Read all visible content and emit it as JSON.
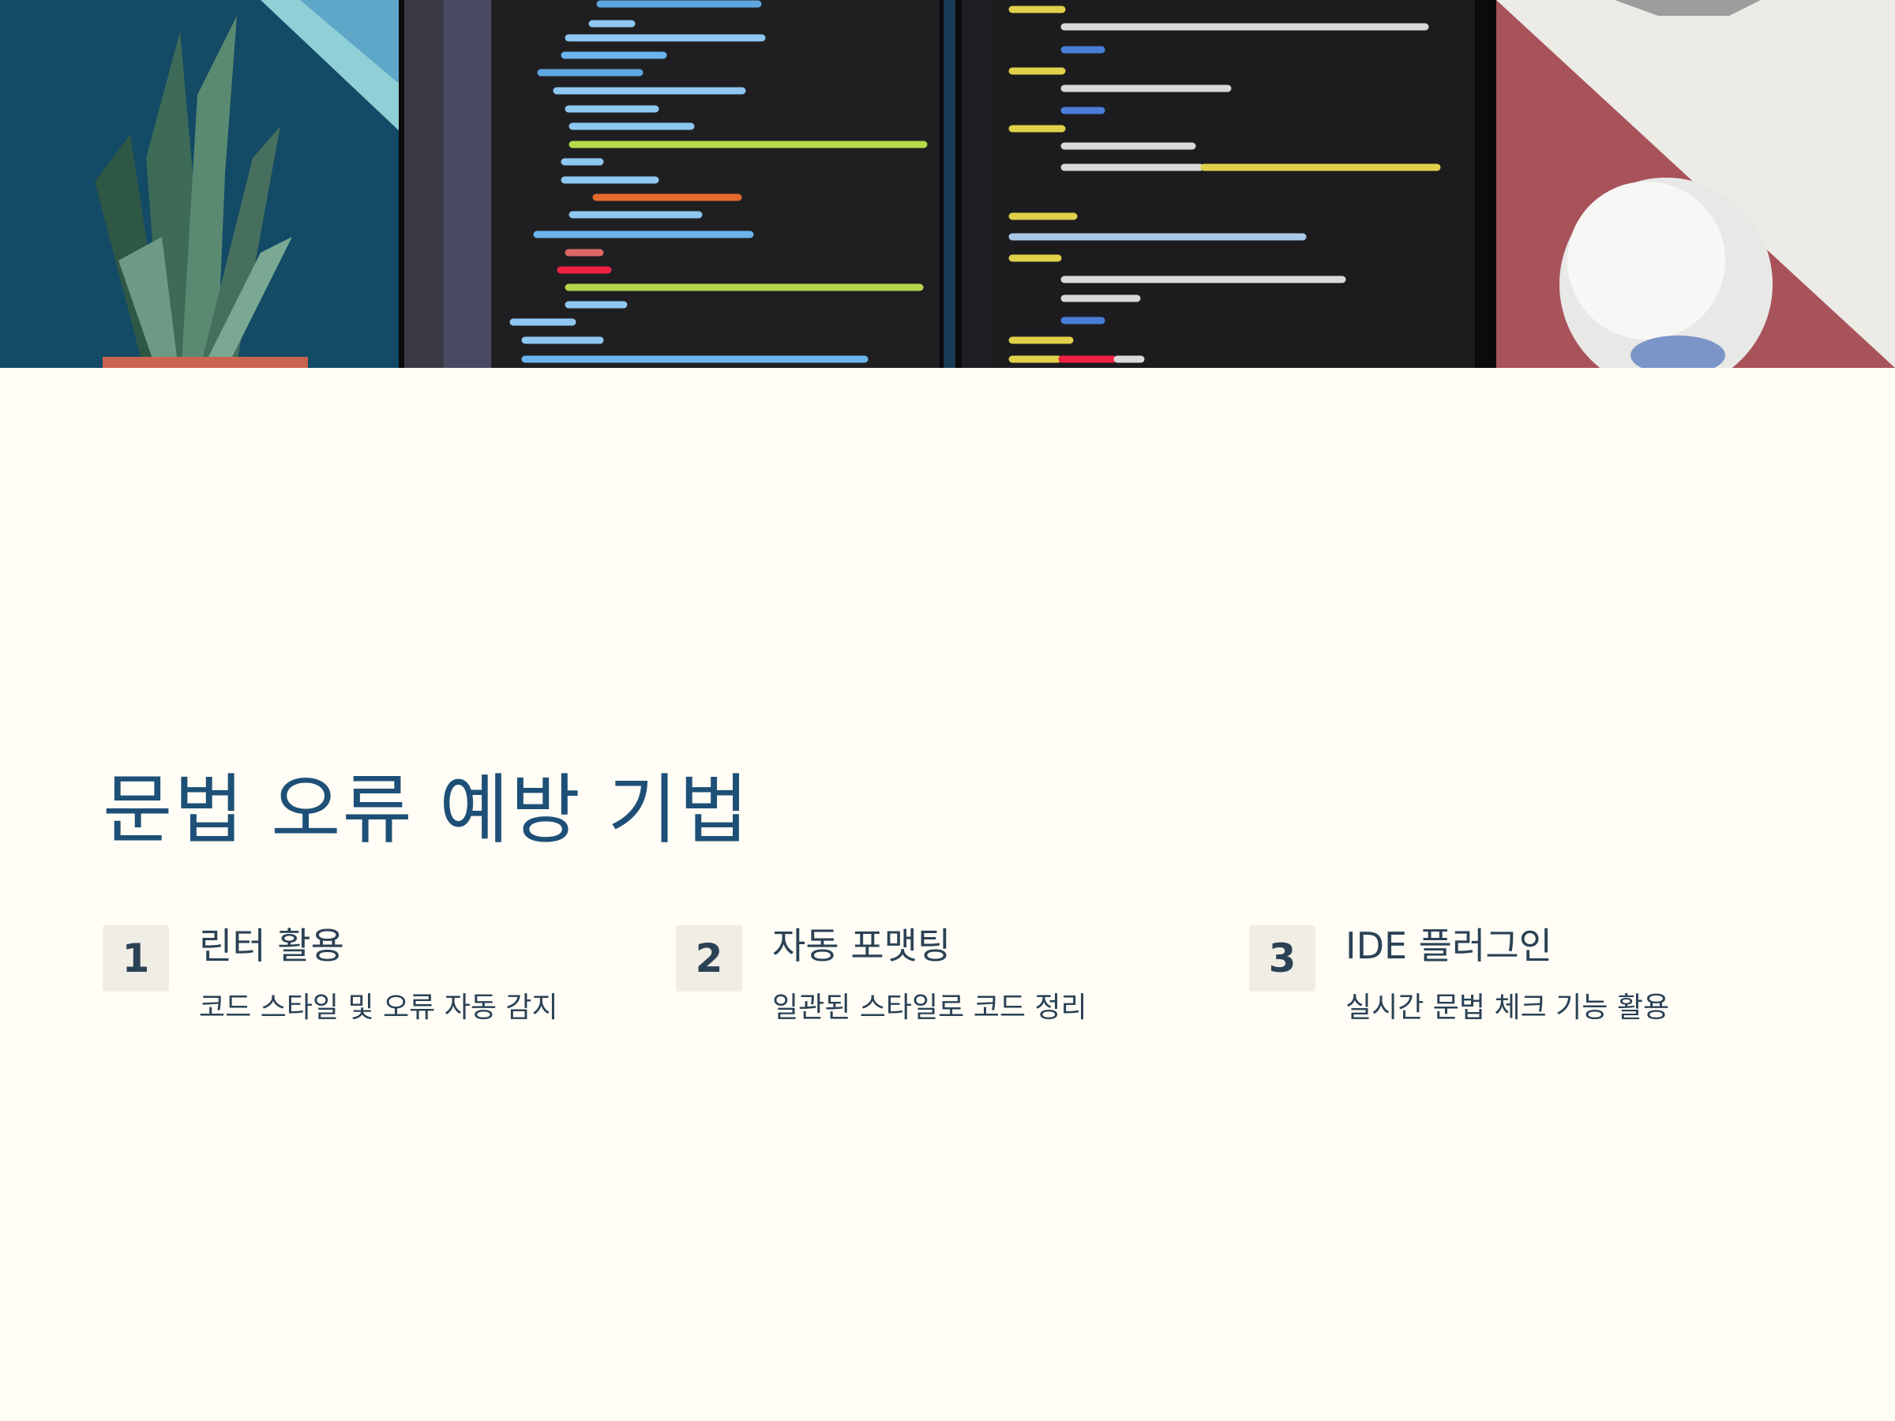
{
  "title": "문법 오류 예방 기법",
  "steps": [
    {
      "number": "1",
      "title": "린터 활용",
      "description": "코드 스타일 및 오류 자동 감지"
    },
    {
      "number": "2",
      "title": "자동 포맷팅",
      "description": "일관된 스타일로 코드 정리"
    },
    {
      "number": "3",
      "title": "IDE 플러그인",
      "description": "실시간 문법 체크 기능 활용"
    }
  ],
  "colors": {
    "background": "#fffdf5",
    "title": "#1e5077",
    "text": "#2b4155",
    "badge": "#f0ede4"
  }
}
